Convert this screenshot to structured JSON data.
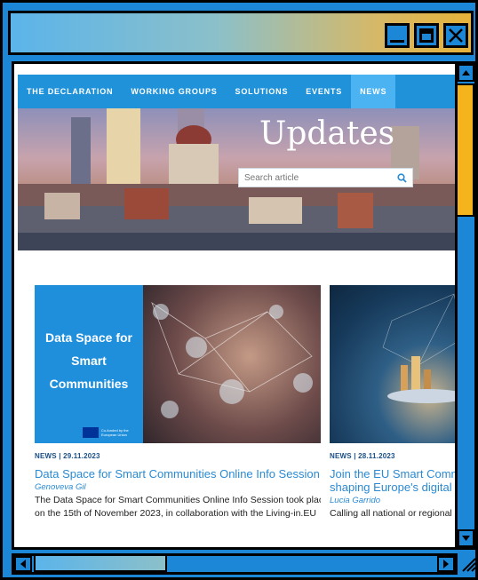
{
  "window": {
    "controls": {
      "minimize": "minimize-icon",
      "maximize": "maximize-icon",
      "close": "close-icon"
    }
  },
  "nav": {
    "items": [
      {
        "label": "THE DECLARATION"
      },
      {
        "label": "WORKING GROUPS"
      },
      {
        "label": "SOLUTIONS"
      },
      {
        "label": "EVENTS"
      },
      {
        "label": "NEWS",
        "active": true
      }
    ]
  },
  "hero": {
    "title": "Updates",
    "search_placeholder": "Search article",
    "search_icon": "search-icon"
  },
  "articles": [
    {
      "thumb_title": "Data Space for Smart Communities",
      "eu_badge": "Co-funded by the European Union",
      "meta": "NEWS | 29.11.2023",
      "title": "Data Space for Smart Communities Online Info Session",
      "author": "Genoveva Gil",
      "desc_line1": "The Data Space for Smart Communities Online Info Session took place",
      "desc_line2": "on the 15th of November 2023, in collaboration with the Living-in.EU"
    },
    {
      "meta": "NEWS | 28.11.2023",
      "title_line1": "Join the EU Smart Commu",
      "title_line2": "shaping Europe's digital fu",
      "author": "Lucia Garrido",
      "desc_line1": "Calling all national or regional a"
    }
  ],
  "colors": {
    "frame": "#1b87d6",
    "nav": "#1f92d9",
    "scroll_thumb": "#f5b41b",
    "link": "#2a8ad3"
  }
}
